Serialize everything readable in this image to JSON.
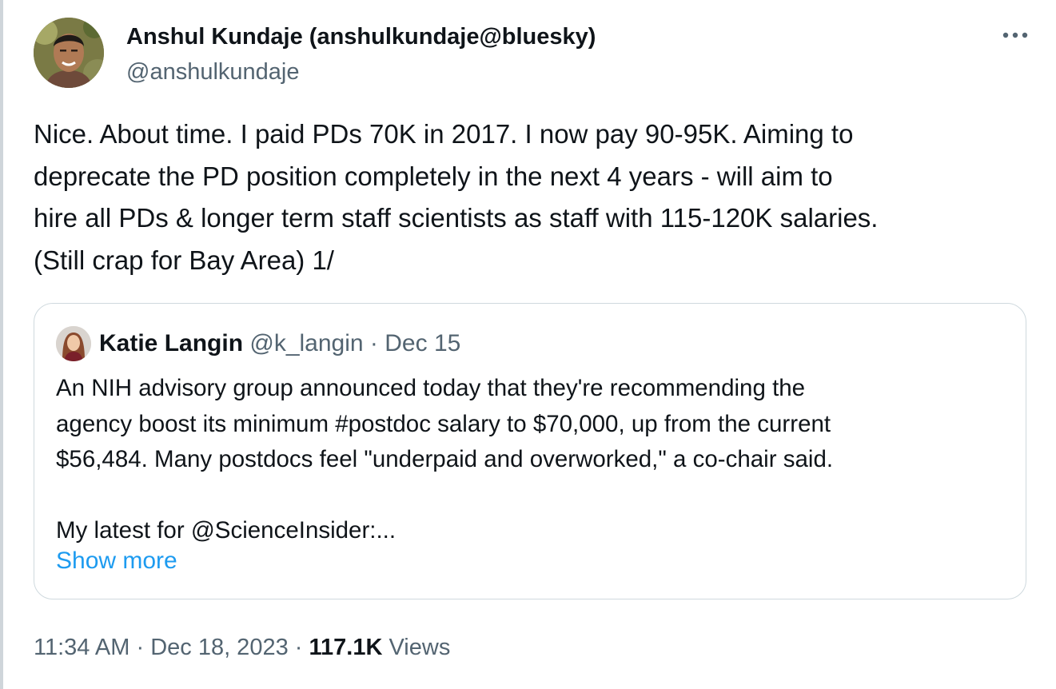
{
  "tweet": {
    "author_name": "Anshul Kundaje (anshulkundaje@bluesky)",
    "author_handle": "@anshulkundaje",
    "text": "Nice. About time. I paid PDs 70K in 2017. I now pay 90-95K. Aiming to\ndeprecate the PD position completely in the next 4 years - will aim to\nhire all PDs & longer term staff scientists as staff with 115-120K salaries.\n(Still crap for Bay Area) 1/",
    "more_icon": "ellipsis-icon"
  },
  "quote": {
    "author_name": "Katie Langin",
    "author_handle": "@k_langin",
    "separator": "·",
    "date": "Dec 15",
    "text": "An NIH advisory group announced today that they're recommending the\nagency boost its minimum #postdoc salary to $70,000, up from the current\n$56,484. Many postdocs feel \"underpaid and overworked,\" a co-chair said.\n\nMy latest for @ScienceInsider:...",
    "show_more": "Show more"
  },
  "footer": {
    "time": "11:34 AM",
    "date": "Dec 18, 2023",
    "separator": "·",
    "views_count": "117.1K",
    "views_label": "Views"
  },
  "colors": {
    "text": "#0f1419",
    "secondary": "#536471",
    "link": "#1d9bf0",
    "border": "#cfd9de"
  }
}
